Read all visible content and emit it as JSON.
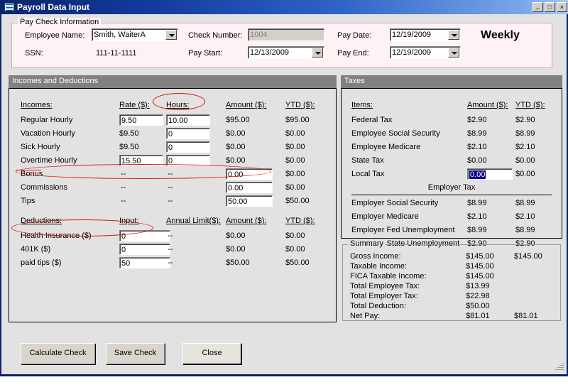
{
  "window": {
    "title": "Payroll Data Input",
    "icon": "payroll-window-icon",
    "minimize_label": "_",
    "maximize_label": "□",
    "close_label": "×"
  },
  "paycheck_info": {
    "legend": "Pay Check Information",
    "employee_name_label": "Employee Name:",
    "employee_name_value": "Smith, WaiterA",
    "ssn_label": "SSN:",
    "ssn_value": "111-11-1111",
    "check_number_label": "Check Number:",
    "check_number_value": "1004",
    "pay_start_label": "Pay Start:",
    "pay_start_value": "12/13/2009",
    "pay_date_label": "Pay Date:",
    "pay_date_value": "12/19/2009",
    "pay_end_label": "Pay End:",
    "pay_end_value": "12/19/2009",
    "pay_frequency": "Weekly"
  },
  "incomes_panel": {
    "header": "Incomes and Deductions",
    "incomes_columns": {
      "name": "Incomes:",
      "rate": "Rate ($):",
      "hours": "Hours:",
      "amount": "Amount ($):",
      "ytd": "YTD ($):"
    },
    "incomes_rows": [
      {
        "name": "Regular Hourly",
        "rate": "9.50",
        "rate_type": "input",
        "hours": "10.00",
        "hours_type": "input",
        "amount": "$95.00",
        "amount_type": "text",
        "ytd": "$95.00"
      },
      {
        "name": "Vacation Hourly",
        "rate": "$9.50",
        "rate_type": "text",
        "hours": "0",
        "hours_type": "input",
        "amount": "$0.00",
        "amount_type": "text",
        "ytd": "$0.00"
      },
      {
        "name": "Sick Hourly",
        "rate": "$9.50",
        "rate_type": "text",
        "hours": "0",
        "hours_type": "input",
        "amount": "$0.00",
        "amount_type": "text",
        "ytd": "$0.00"
      },
      {
        "name": "Overtime Hourly",
        "rate": "15.50",
        "rate_type": "input",
        "hours": "0",
        "hours_type": "input",
        "amount": "$0.00",
        "amount_type": "text",
        "ytd": "$0.00"
      },
      {
        "name": "Bonus",
        "rate": "--",
        "rate_type": "dash",
        "hours": "--",
        "hours_type": "dash",
        "amount": "0.00",
        "amount_type": "input",
        "ytd": "$0.00"
      },
      {
        "name": "Commissions",
        "rate": "--",
        "rate_type": "dash",
        "hours": "--",
        "hours_type": "dash",
        "amount": "0.00",
        "amount_type": "input",
        "ytd": "$0.00"
      },
      {
        "name": "Tips",
        "rate": "--",
        "rate_type": "dash",
        "hours": "--",
        "hours_type": "dash",
        "amount": "50.00",
        "amount_type": "input",
        "ytd": "$50.00"
      }
    ],
    "deductions_columns": {
      "name": "Deductions:",
      "input": "Input:",
      "annual_limit": "Annual Limit($):",
      "amount": "Amount ($):",
      "ytd": "YTD ($):"
    },
    "deductions_rows": [
      {
        "name": "Health Insurance  ($)",
        "input": "0",
        "annual_limit": "--",
        "amount": "$0.00",
        "ytd": "$0.00"
      },
      {
        "name": "401K  ($)",
        "input": "0",
        "annual_limit": "--",
        "amount": "$0.00",
        "ytd": "$0.00"
      },
      {
        "name": "paid tips  ($)",
        "input": "50",
        "annual_limit": "--",
        "amount": "$50.00",
        "ytd": "$50.00"
      }
    ]
  },
  "taxes_panel": {
    "header": "Taxes",
    "columns": {
      "items": "Items:",
      "amount": "Amount ($):",
      "ytd": "YTD ($):"
    },
    "employee_rows": [
      {
        "name": "Federal Tax",
        "amount": "$2.90",
        "amount_type": "text",
        "ytd": "$2.90"
      },
      {
        "name": "Employee Social Security",
        "amount": "$8.99",
        "amount_type": "text",
        "ytd": "$8.99"
      },
      {
        "name": "Employee Medicare",
        "amount": "$2.10",
        "amount_type": "text",
        "ytd": "$2.10"
      },
      {
        "name": "State Tax",
        "amount": "$0.00",
        "amount_type": "text",
        "ytd": "$0.00"
      },
      {
        "name": "Local Tax",
        "amount": "0.00",
        "amount_type": "input-selected",
        "ytd": "$0.00"
      }
    ],
    "employer_section_title": "Employer Tax",
    "employer_rows": [
      {
        "name": "Employer Social Security",
        "amount": "$8.99",
        "ytd": "$8.99"
      },
      {
        "name": "Employer Medicare",
        "amount": "$2.10",
        "ytd": "$2.10"
      },
      {
        "name": "Employer Fed Unemployment",
        "amount": "$8.99",
        "ytd": "$8.99"
      },
      {
        "name": "Employer State Unemployment",
        "amount": "$2.90",
        "ytd": "$2.90"
      }
    ],
    "summary": {
      "legend": "Summary",
      "rows": [
        {
          "name": "Gross Income:",
          "amount": "$145.00",
          "ytd": "$145.00"
        },
        {
          "name": "Taxable Income:",
          "amount": "$145.00",
          "ytd": ""
        },
        {
          "name": "FICA Taxable Income:",
          "amount": "$145.00",
          "ytd": ""
        },
        {
          "name": "Total Employee Tax:",
          "amount": "$13.99",
          "ytd": ""
        },
        {
          "name": "Total Employer Tax:",
          "amount": "$22.98",
          "ytd": ""
        },
        {
          "name": "Total Deduction:",
          "amount": "$50.00",
          "ytd": ""
        },
        {
          "name": "Net Pay:",
          "amount": "$81.01",
          "ytd": "$81.01"
        }
      ]
    }
  },
  "buttons": {
    "calculate": "Calculate Check",
    "save": "Save Check",
    "close": "Close"
  },
  "colors": {
    "titlebar_start": "#0a246a",
    "titlebar_end": "#a9c9f5",
    "panel_header": "#808080",
    "face": "#e2e2e2",
    "annotation": "#dd1111",
    "selection": "#000080"
  }
}
